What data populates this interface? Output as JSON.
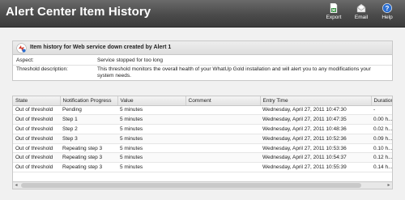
{
  "window": {
    "title": "Alert Center Item History"
  },
  "toolbar": {
    "export_label": "Export",
    "email_label": "Email",
    "help_label": "Help"
  },
  "details": {
    "header": "Item history for Web service down created by Alert 1",
    "aspect_label": "Aspect:",
    "aspect_value": "Service stopped for too long",
    "threshold_label": "Threshold description:",
    "threshold_value": "This threshold monitors the overall health of your WhatUp Gold installation and will alert you to any modifications your system needs."
  },
  "history": {
    "columns": [
      "State",
      "Notification Progress",
      "Value",
      "Comment",
      "Entry Time",
      "Duration"
    ],
    "rows": [
      [
        "Out of threshold",
        "Pending",
        "5 minutes",
        "",
        "Wednesday, April 27, 2011 10:47:30",
        "-"
      ],
      [
        "Out of threshold",
        "Step 1",
        "5 minutes",
        "",
        "Wednesday, April 27, 2011 10:47:35",
        "0.00 h..."
      ],
      [
        "Out of threshold",
        "Step 2",
        "5 minutes",
        "",
        "Wednesday, April 27, 2011 10:48:36",
        "0.02 h..."
      ],
      [
        "Out of threshold",
        "Step 3",
        "5 minutes",
        "",
        "Wednesday, April 27, 2011 10:52:36",
        "0.09 h..."
      ],
      [
        "Out of threshold",
        "Repeating step 3",
        "5 minutes",
        "",
        "Wednesday, April 27, 2011 10:53:36",
        "0.10 h..."
      ],
      [
        "Out of threshold",
        "Repeating step 3",
        "5 minutes",
        "",
        "Wednesday, April 27, 2011 10:54:37",
        "0.12 h..."
      ],
      [
        "Out of threshold",
        "Repeating step 3",
        "5 minutes",
        "",
        "Wednesday, April 27, 2011 10:55:39",
        "0.14 h..."
      ]
    ]
  },
  "colors": {
    "titlebar": "#4b4b4b",
    "help_icon": "#2d6fd0",
    "export_icon": "#2e8b3a"
  }
}
